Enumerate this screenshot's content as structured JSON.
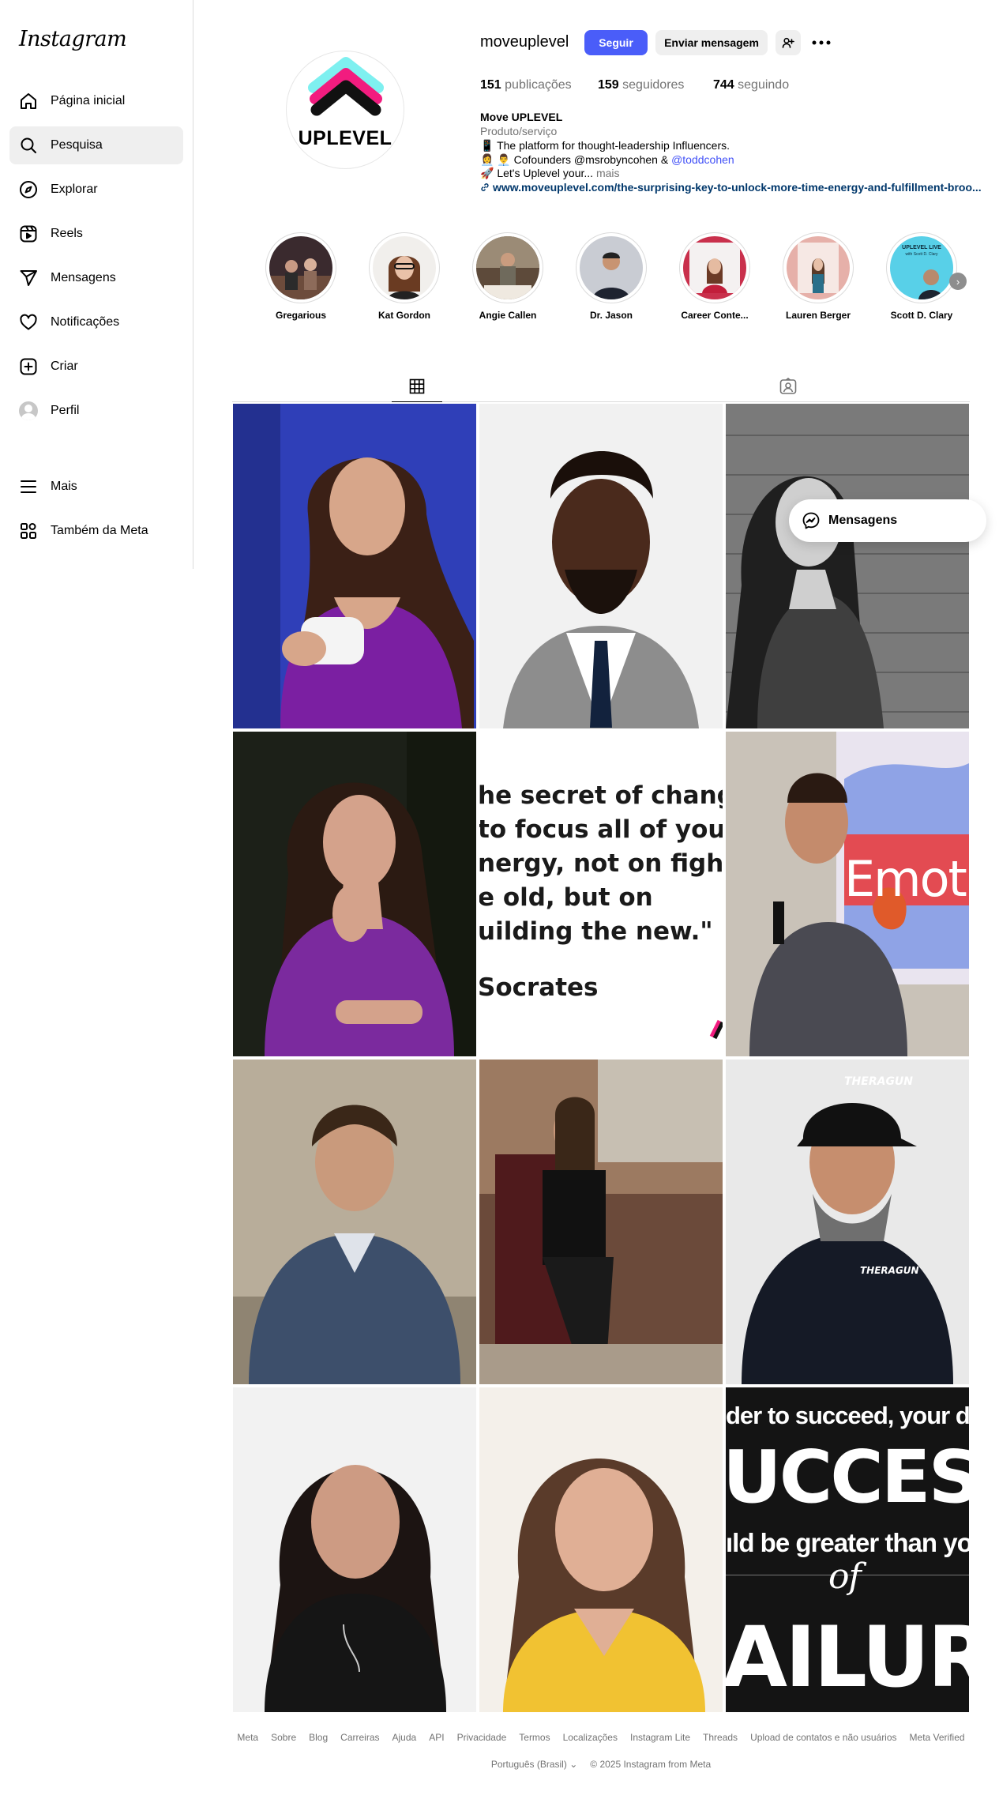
{
  "app": {
    "logo": "Instagram"
  },
  "sidebar": {
    "items": [
      {
        "label": "Página inicial",
        "icon": "home-icon"
      },
      {
        "label": "Pesquisa",
        "icon": "search-icon",
        "active": true
      },
      {
        "label": "Explorar",
        "icon": "compass-icon"
      },
      {
        "label": "Reels",
        "icon": "reels-icon"
      },
      {
        "label": "Mensagens",
        "icon": "send-icon"
      },
      {
        "label": "Notificações",
        "icon": "heart-icon"
      },
      {
        "label": "Criar",
        "icon": "plus-square-icon"
      },
      {
        "label": "Perfil",
        "icon": "avatar"
      },
      {
        "label": "Mais",
        "icon": "menu-icon"
      },
      {
        "label": "Também da Meta",
        "icon": "meta-apps-icon"
      }
    ]
  },
  "profile": {
    "brand_text": "UPLEVEL",
    "username": "moveuplevel",
    "follow_label": "Seguir",
    "message_label": "Enviar mensagem",
    "stats": {
      "posts_value": "151",
      "posts_label": "publicações",
      "followers_value": "159",
      "followers_label": "seguidores",
      "following_value": "744",
      "following_label": "seguindo"
    },
    "bio": {
      "name": "Move UPLEVEL",
      "category": "Produto/serviço",
      "line1": "📱 The platform for thought-leadership Influencers.",
      "line2_text": "👩‍💼 👨‍💼 Cofounders @msrobyncohen & ",
      "line2_link": "@toddcohen",
      "line3_text": "🚀 Let's Uplevel your... ",
      "line3_more": "mais",
      "url": "www.moveuplevel.com/the-surprising-key-to-unlock-more-time-energy-and-fulfillment-broo..."
    }
  },
  "highlights": [
    {
      "name": "Gregarious"
    },
    {
      "name": "Kat Gordon"
    },
    {
      "name": "Angie Callen"
    },
    {
      "name": "Dr. Jason"
    },
    {
      "name": "Career Conte..."
    },
    {
      "name": "Lauren Berger"
    },
    {
      "name": "Scott D. Clary"
    }
  ],
  "highlight_tile": {
    "line1": "UPLEVEL LIVE",
    "line2": "with Scott D. Clary"
  },
  "tabs": [
    {
      "icon": "grid-icon",
      "active": true
    },
    {
      "icon": "tagged-icon",
      "active": false
    }
  ],
  "posts": {
    "quote": {
      "lines": [
        "he secret of change",
        " to focus all of your",
        "nergy, not on fightin",
        "e old, but on",
        "uilding the new.\""
      ],
      "author": "Socrates"
    },
    "emotion_text": "Emoti",
    "cap_text": "THERAGUN",
    "shirt_text": "THERAGUN",
    "success": {
      "line1": "der to succeed, your desi",
      "big1": "UCCES",
      "line2": "ıld be greater than your",
      "of": "of",
      "big2": "AILUR"
    }
  },
  "floating_messages": {
    "label": "Mensagens"
  },
  "footer": {
    "links": [
      "Meta",
      "Sobre",
      "Blog",
      "Carreiras",
      "Ajuda",
      "API",
      "Privacidade",
      "Termos",
      "Localizações",
      "Instagram Lite",
      "Threads",
      "Upload de contatos e não usuários",
      "Meta Verified"
    ],
    "language": "Português (Brasil)",
    "copyright": "© 2025 Instagram from Meta"
  }
}
